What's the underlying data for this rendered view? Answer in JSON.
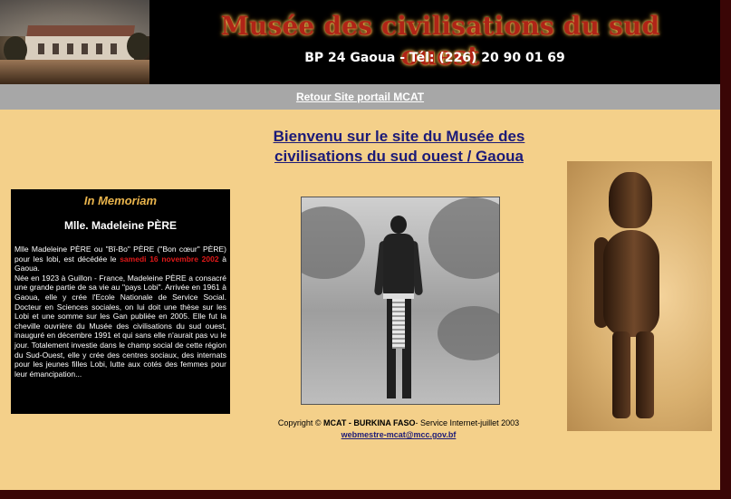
{
  "header": {
    "title": "Musée des civilisations du sud ouest",
    "contact": "BP 24 Gaoua - Tél: (226) 20 90 01 69"
  },
  "nav": {
    "link_label": "Retour Site portail MCAT"
  },
  "welcome": {
    "line1": "Bienvenu sur le site du Musée des",
    "line2": "civilisations du sud ouest / Gaoua"
  },
  "memorial": {
    "title": "In Memoriam",
    "name": "Mlle. Madeleine PÈRE",
    "text_part1": "Mlle Madeleine PÈRE ou \"Bî-Bo\" PÈRE (\"Bon cœur\" PÈRE) pour les lobi, est décédée le ",
    "date_highlight": "samedi 16 novembre 2002",
    "text_part2": " à Gaoua.",
    "text_part3": "Née en 1923 à Guillon - France, Madeleine PÈRE a consacré une grande partie de sa vie au \"pays Lobi\". Arrivée en 1961 à Gaoua, elle y crée l'Ecole Nationale de Service Social. Docteur en Sciences sociales, on lui doit une thèse sur les Lobi et une somme sur les Gan publiée en 2005. Elle fut la cheville ouvrière du Musée des civilisations du sud ouest, inauguré en décembre 1991 et qui sans elle n'aurait pas vu le jour. Totalement investie dans le champ social de cette région du Sud-Ouest, elle y crée des centres sociaux, des internats pour les jeunes filles Lobi, lutte aux cotés des femmes pour leur émancipation..."
  },
  "footer": {
    "copyright_prefix": "Copyright © ",
    "copyright_org": "MCAT - BURKINA FASO",
    "copyright_suffix": "- Service Internet-juillet 2003",
    "email": "webmestre-mcat@mcc.gov.bf"
  },
  "colors": {
    "page_background": "#f4d08a",
    "header_background": "#000000",
    "nav_background": "#a7a7a7",
    "title_red": "#b02417",
    "link_blue": "#1c1a78",
    "memorial_title": "#e9b44c",
    "date_red": "#e01919",
    "frame": "#3a0606"
  }
}
